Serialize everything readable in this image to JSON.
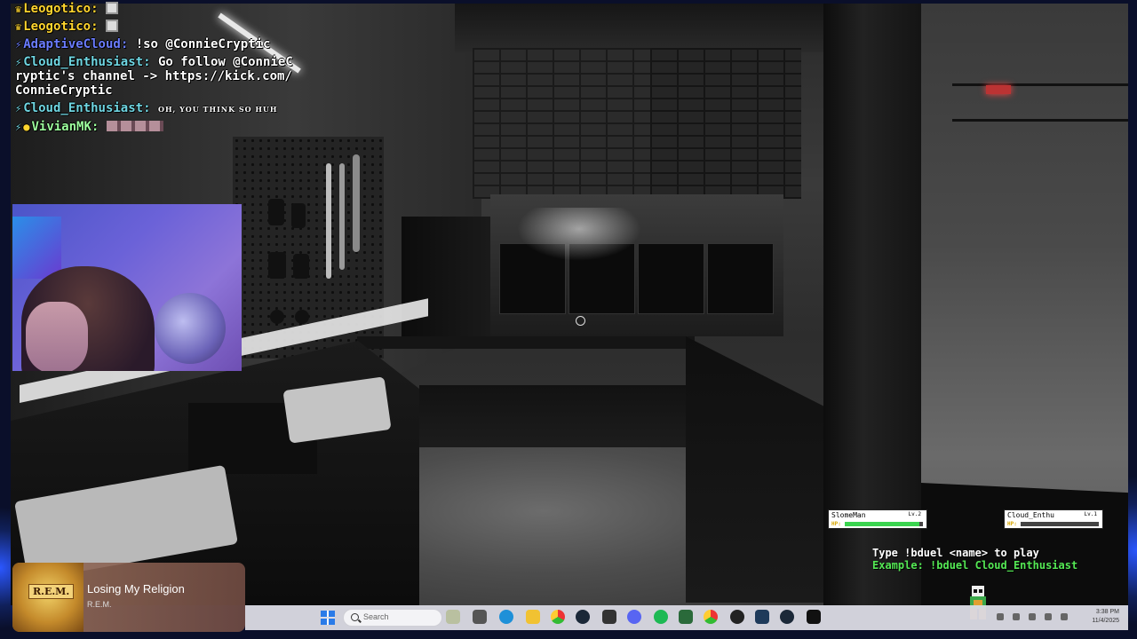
{
  "chat": {
    "messages": [
      {
        "user": "Leogotico",
        "text": ""
      },
      {
        "user": "Leogotico",
        "text": ""
      },
      {
        "user": "AdaptiveCloud",
        "text": "!so @ConnieCryptic"
      },
      {
        "user": "Cloud_Enthusiast",
        "text": "Go follow @ConnieCryptic's channel -> https://kick.com/ConnieCryptic"
      },
      {
        "user": "Cloud_Enthusiast",
        "text": "OH, YOU THINK SO HUH"
      },
      {
        "user": "VivianMK",
        "text": ""
      }
    ]
  },
  "now_playing": {
    "title": "Losing My Religion",
    "artist": "R.E.M.",
    "album_label": "R.E.M."
  },
  "duel": {
    "player1": {
      "name": "SlomeMan",
      "level": "Lv.2",
      "hp_label": "HP:",
      "hp_fraction": 0.95
    },
    "player2": {
      "name": "Cloud_Enthu",
      "level": "Lv.1",
      "hp_label": "HP:",
      "hp_fraction": 0.0
    },
    "instruction": "Type !bduel <name> to play",
    "example": "Example: !bduel Cloud_Enthusiast"
  },
  "taskbar": {
    "search_placeholder": "Search",
    "time": "3:38 PM",
    "date": "11/4/2025"
  },
  "colors": {
    "gold_user": "#ffd52e",
    "blue_user": "#6a7cff",
    "teal_user": "#6fd6e2",
    "green_user": "#9dff9d",
    "duel_example": "#54e854",
    "hp_fill": "#3ad44f"
  }
}
